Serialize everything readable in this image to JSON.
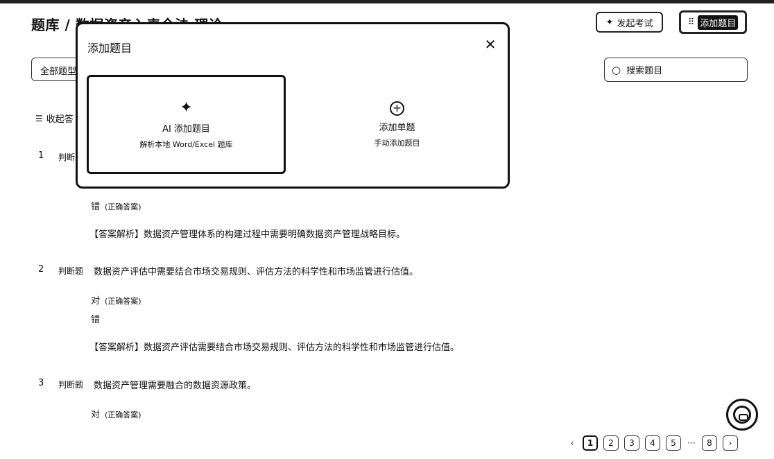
{
  "header": {
    "breadcrumb": "题库 / 数据资产入表全法 理论 ...",
    "exam_button": "发起考试",
    "add_button": "添加题目"
  },
  "toolbar": {
    "filter_value": "全部题型",
    "search_placeholder": "搜索题目",
    "collapse_label": "收起答"
  },
  "questions": [
    {
      "number": "1",
      "type": "判断",
      "text": "",
      "options": [
        {
          "label": "错",
          "tag": "(正确答案)"
        }
      ],
      "explanation": "【答案解析】数据资产管理体系的构建过程中需要明确数据资产管理战略目标。"
    },
    {
      "number": "2",
      "type": "判断题",
      "text": "数据资产评估中需要结合市场交易规则、评估方法的科学性和市场监管进行估值。",
      "options": [
        {
          "label": "对",
          "tag": "(正确答案)"
        },
        {
          "label": "错",
          "tag": ""
        }
      ],
      "explanation": "【答案解析】数据资产评估需要结合市场交易规则、评估方法的科学性和市场监管进行估值。"
    },
    {
      "number": "3",
      "type": "判断题",
      "text": "数据资产管理需要融合的数据资源政策。",
      "options": [
        {
          "label": "对",
          "tag": "(正确答案)"
        }
      ],
      "explanation": ""
    }
  ],
  "modal": {
    "title": "添加题目",
    "close_icon": "close-icon",
    "cards": [
      {
        "icon": "sparkle-icon",
        "title": "AI 添加题目",
        "desc": "解析本地 Word/Excel 题库"
      },
      {
        "icon": "plus-circle-icon",
        "title": "添加单题",
        "desc": "手动添加题目"
      }
    ]
  },
  "pagination": {
    "prev": "‹",
    "pages": [
      "1",
      "2",
      "3",
      "4",
      "5"
    ],
    "ellipsis": "···",
    "last": "8",
    "next": "›",
    "current": "1"
  }
}
